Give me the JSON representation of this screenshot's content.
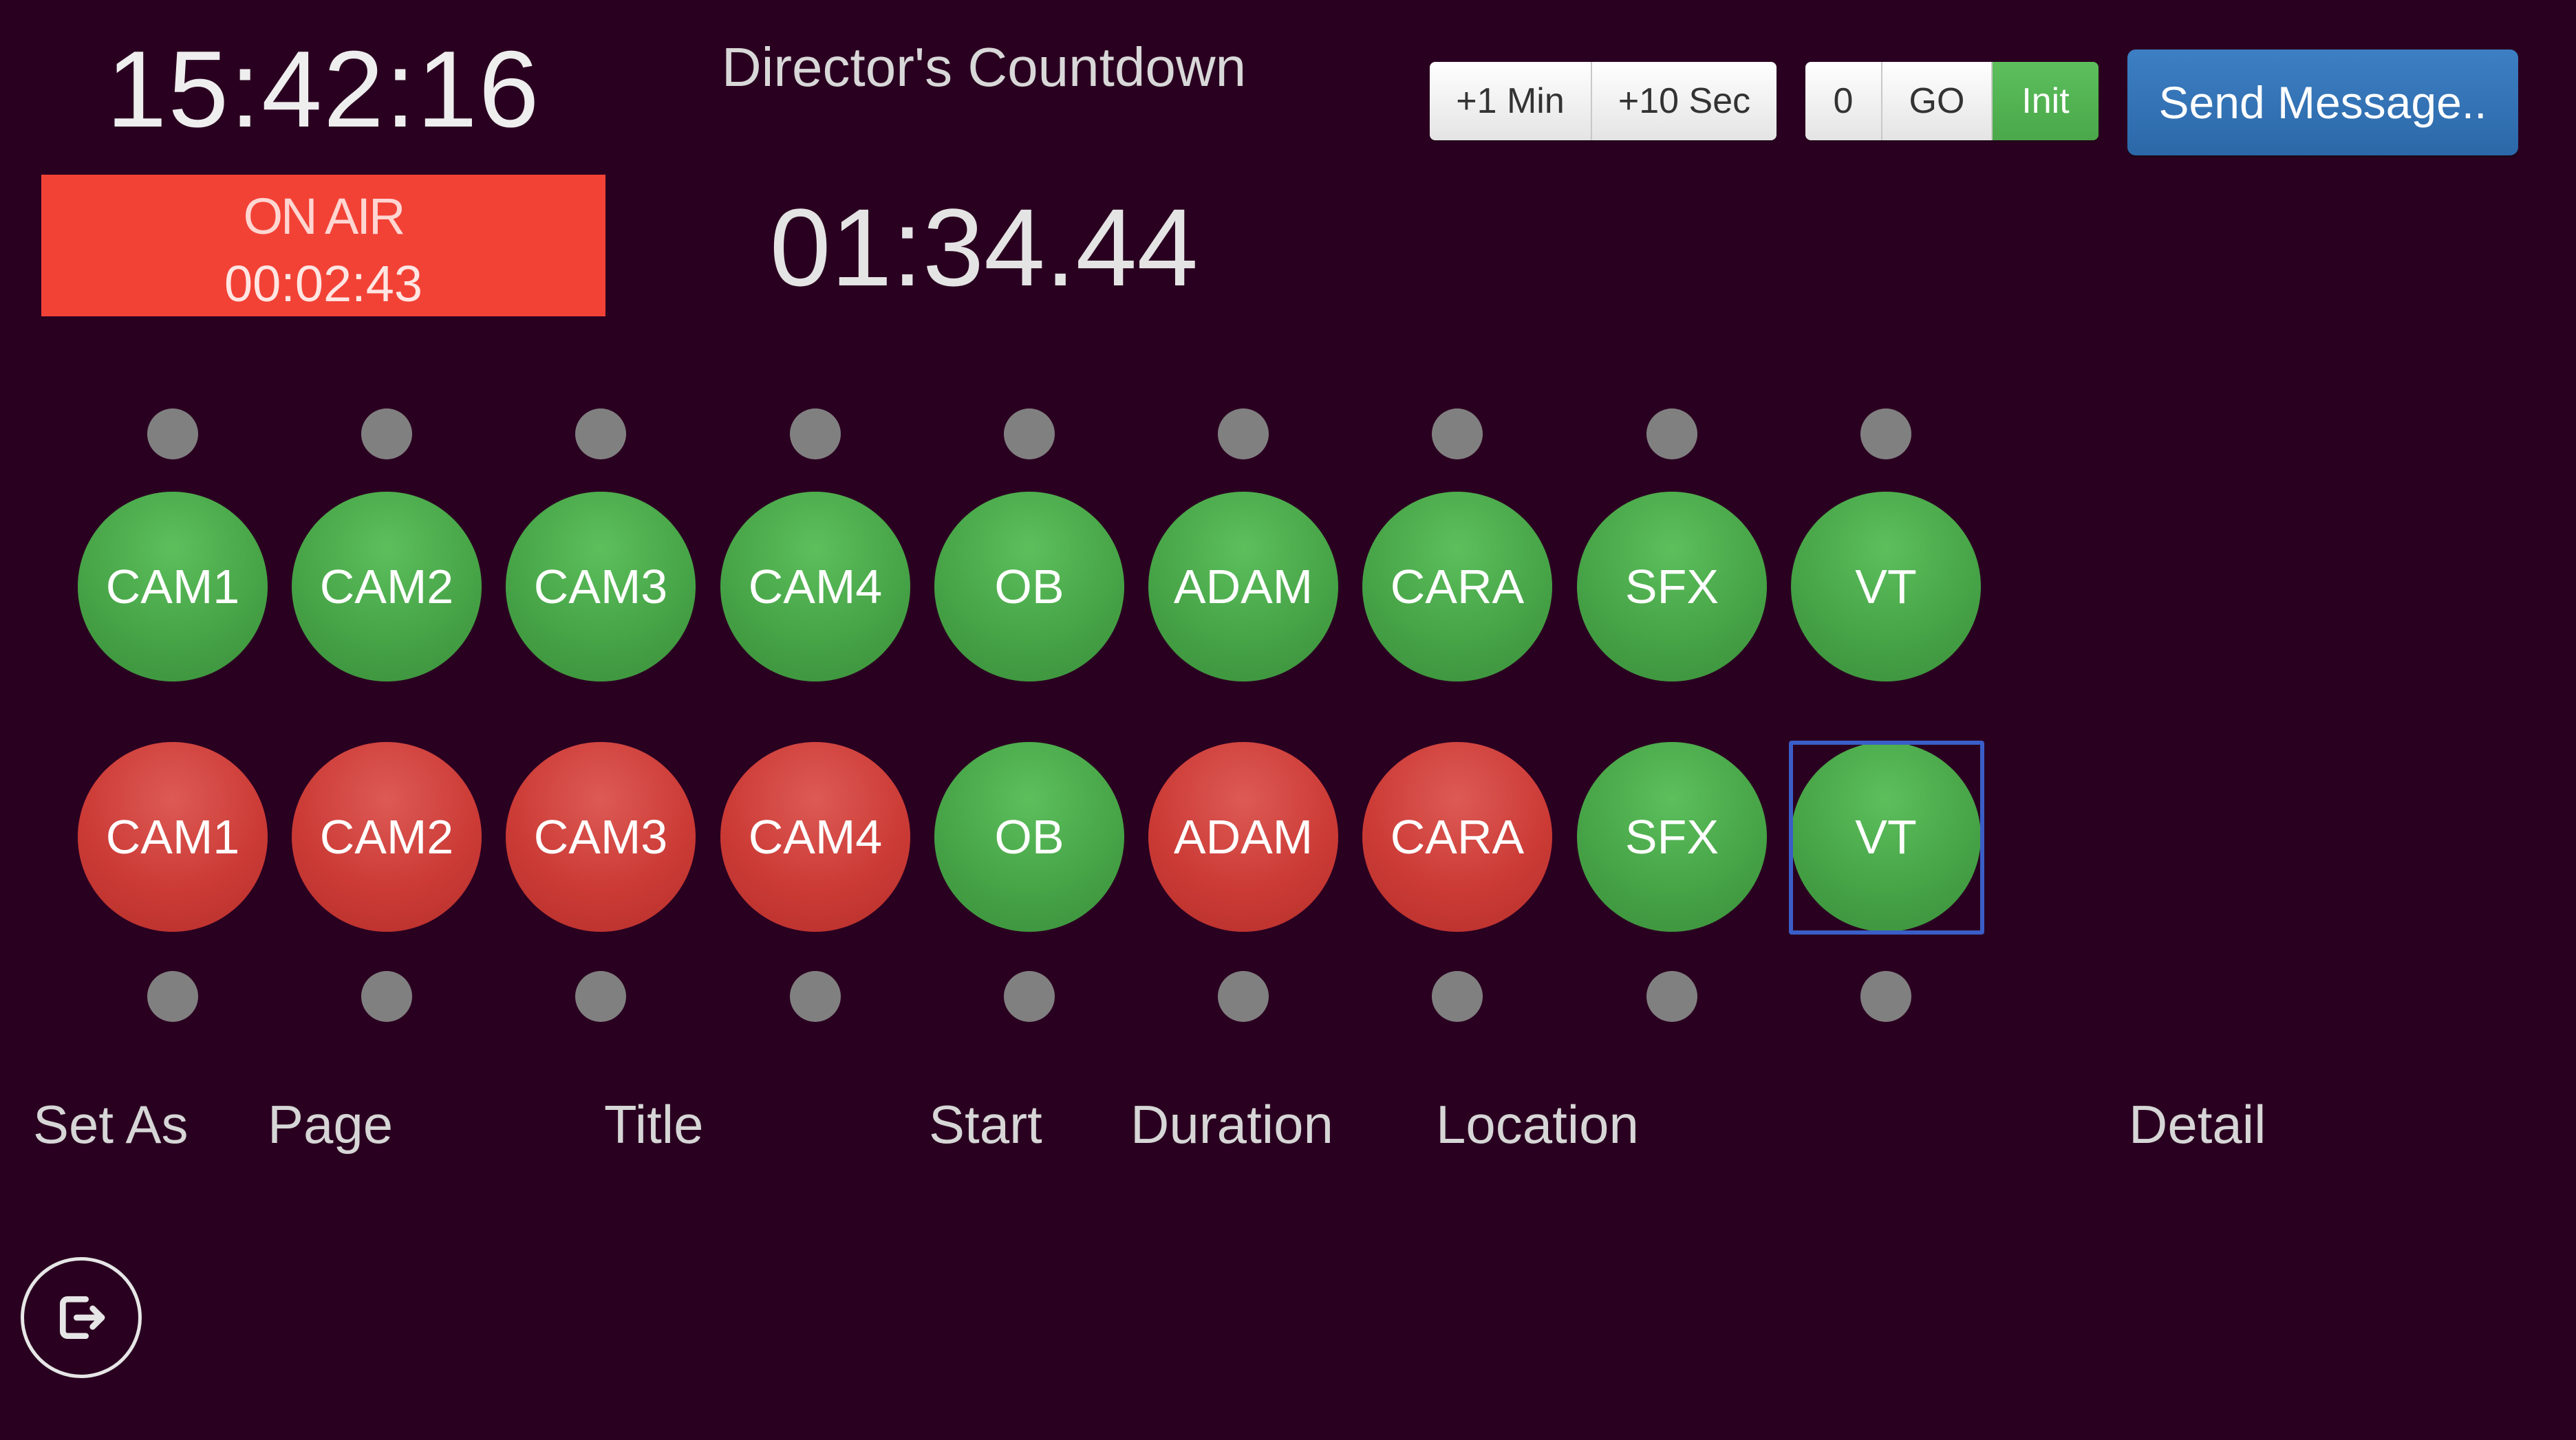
{
  "clock": "15:42:16",
  "on_air": {
    "label": "ON AIR",
    "elapsed": "00:02:43",
    "color": "#f24236"
  },
  "title": "Director's Countdown",
  "countdown": "01:34.44",
  "time_buttons": [
    "+1 Min",
    "+10 Sec"
  ],
  "control_buttons": [
    "0",
    "GO",
    "Init"
  ],
  "send_button": "Send Message..",
  "colors": {
    "background": "#2a0020",
    "green": "#47a447",
    "red": "#cc3b36",
    "dot": "#808080",
    "send": "#3073b8",
    "selection": "#3a5ec8"
  },
  "row_top": [
    {
      "label": "CAM1",
      "state": "green"
    },
    {
      "label": "CAM2",
      "state": "green"
    },
    {
      "label": "CAM3",
      "state": "green"
    },
    {
      "label": "CAM4",
      "state": "green"
    },
    {
      "label": "OB",
      "state": "green"
    },
    {
      "label": "ADAM",
      "state": "green"
    },
    {
      "label": "CARA",
      "state": "green"
    },
    {
      "label": "SFX",
      "state": "green"
    },
    {
      "label": "VT",
      "state": "green"
    }
  ],
  "row_bottom": [
    {
      "label": "CAM1",
      "state": "red"
    },
    {
      "label": "CAM2",
      "state": "red"
    },
    {
      "label": "CAM3",
      "state": "red"
    },
    {
      "label": "CAM4",
      "state": "red"
    },
    {
      "label": "OB",
      "state": "green"
    },
    {
      "label": "ADAM",
      "state": "red"
    },
    {
      "label": "CARA",
      "state": "red"
    },
    {
      "label": "SFX",
      "state": "green"
    },
    {
      "label": "VT",
      "state": "green"
    }
  ],
  "selected_source": "VT",
  "columns": [
    "Set As",
    "Page",
    "Title",
    "Start",
    "Duration",
    "Location",
    "Detail"
  ],
  "logout_icon": "logout-icon"
}
